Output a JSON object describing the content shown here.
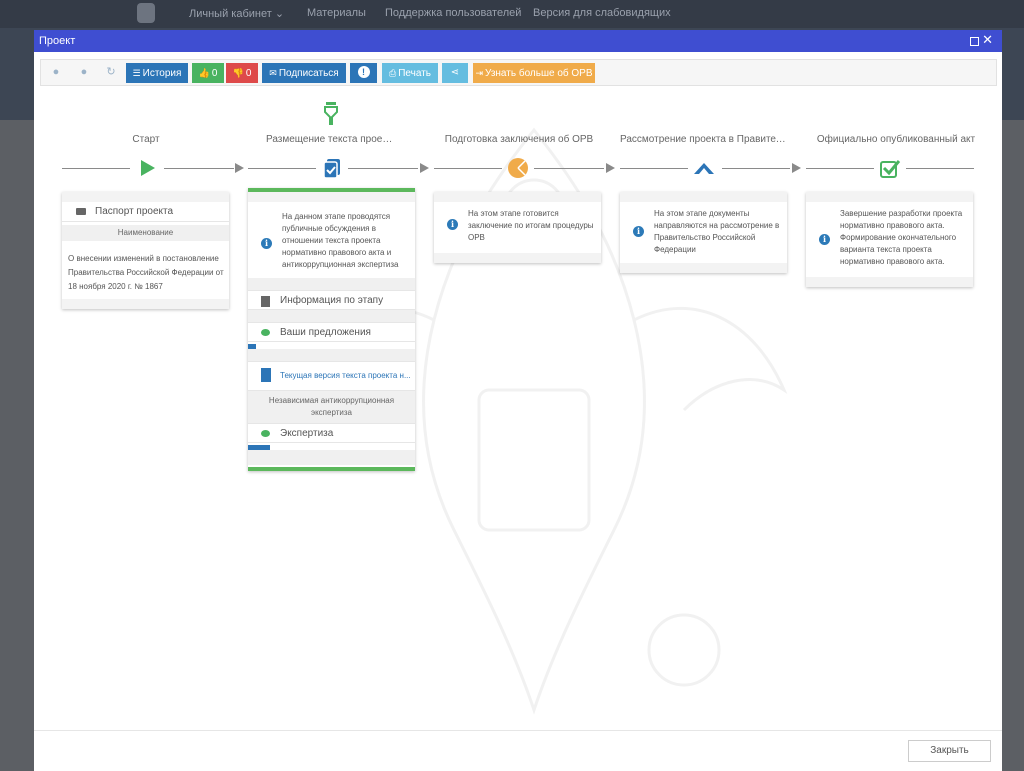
{
  "topnav": {
    "items": [
      "Личный кабинет",
      "Материалы",
      "Поддержка пользователей",
      "Версия для слабовидящих"
    ]
  },
  "modal": {
    "title": "Проект"
  },
  "toolbar": {
    "history": "История",
    "likes": "0",
    "dislikes": "0",
    "subscribe": "Подписаться",
    "print": "Печать",
    "learn_more": "Узнать больше об ОРВ"
  },
  "stages": [
    {
      "title": "Старт",
      "icon": "play-icon",
      "color": "#49b360"
    },
    {
      "title": "Размещение текста проекта",
      "icon": "document-check-icon",
      "color": "#2c75b7"
    },
    {
      "title": "Подготовка заключения об ОРВ",
      "icon": "pie-chart-icon",
      "color": "#f0ab4a"
    },
    {
      "title": "Рассмотрение проекта в Правительст...",
      "icon": "arrow-up-icon",
      "color": "#2c75b7"
    },
    {
      "title": "Официально опубликованный акт",
      "icon": "checked-box-icon",
      "color": "#49b360"
    }
  ],
  "cards": {
    "start": {
      "passport": "Паспорт проекта",
      "name_header": "Наименование",
      "name_lines": [
        "О внесении изменений в постановление",
        "Правительства Российской Федерации от",
        "18 ноября 2020 г. № 1867"
      ]
    },
    "publishing": {
      "info_lines": [
        "На данном этапе проводятся",
        "публичные обсуждения в",
        "отношении текста проекта",
        "нормативно правового акта и",
        "антикоррупционная экспертиза"
      ],
      "stage_info": "Информация по этапу",
      "proposals": "Ваши предложения",
      "current_version": "Текущая версия текста проекта н...",
      "anticorruption_header_lines": [
        "Независимая антикоррупционная",
        "экспертиза"
      ],
      "expertise": "Экспертиза"
    },
    "preparation": {
      "info_lines": [
        "На этом этапе готовится",
        "заключение по итогам процедуры",
        "ОРВ"
      ]
    },
    "government": {
      "info_lines": [
        "На этом этапе документы",
        "направляются на рассмотрение в",
        "Правительство Российской",
        "Федерации"
      ]
    },
    "published": {
      "info_lines": [
        "Завершение разработки проекта",
        "нормативно правового акта.",
        "Формирование окончательного",
        "варианта текста проекта",
        "нормативно правового акта."
      ]
    }
  },
  "footer": {
    "close": "Закрыть"
  }
}
